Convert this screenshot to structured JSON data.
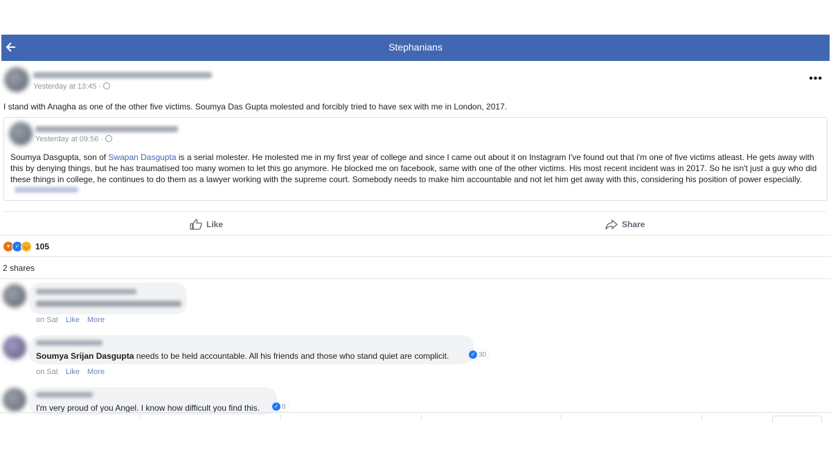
{
  "header": {
    "title": "Stephanians"
  },
  "post": {
    "time": "Yesterday at 13:45 ·",
    "text": "I stand with Anagha as one of the other five victims. Soumya Das Gupta molested and forcibly tried to have sex with me in London, 2017.",
    "shared": {
      "time": "Yesterday at 09:56 ·",
      "text_pre": "Soumya Dasgupta, son of ",
      "link": "Swapan Dasgupta",
      "text_post": " is a serial molester. He molested me in my first year of college and since I came out about it on Instagram I've found out that i'm one of five victims atleast. He gets away with this by denying things, but he has traumatised too many women to let this go anymore. He blocked me on facebook, same with one of the other victims. His most recent incident was in 2017. So he isn't just a guy who did these things in college, he continues to do them as a lawyer working with the supreme court. Somebody needs to make him accountable and not let him get away with this, considering his position of power especially."
    },
    "actions": {
      "like": "Like",
      "share": "Share"
    },
    "reactions_count": "105",
    "shares": "2 shares"
  },
  "comments": [
    {
      "time": "on Sat",
      "like": "Like",
      "more": "More"
    },
    {
      "name": "Soumya Srijan Dasgupta",
      "text": " needs to be held accountable. All his friends and those who stand quiet are complicit.",
      "likes": "30",
      "time": "on Sat",
      "like": "Like",
      "more": "More"
    },
    {
      "text": "I'm very proud of you Angel. I know how difficult you find this.",
      "likes": "8"
    }
  ],
  "colors": {
    "header": "#4267b2",
    "link": "#4267b2",
    "like_badge": "#2078f4"
  }
}
